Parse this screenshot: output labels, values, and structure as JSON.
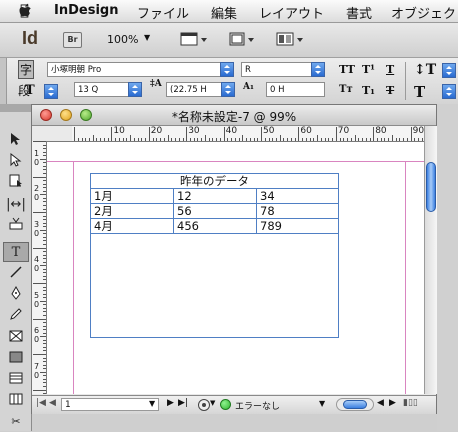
{
  "menubar": {
    "app_name": "InDesign",
    "items": [
      "ファイル",
      "編集",
      "レイアウト",
      "書式",
      "オブジェク"
    ]
  },
  "appbar": {
    "app_logo": "Id",
    "bridge_label": "Br",
    "zoom": "100%"
  },
  "control_panel": {
    "font_family": "小塚明朝 Pro",
    "font_style": "R",
    "font_size": "13 Q",
    "leading": "(22.75 H",
    "tracking": "0 H",
    "char_panel_label": "字",
    "para_panel_label": "段"
  },
  "document": {
    "title": "*名称未設定-7 @ 99%",
    "hruler_labels": [
      "10",
      "20",
      "30",
      "40",
      "50",
      "60",
      "70",
      "80",
      "90",
      "100"
    ],
    "vruler_labels": [
      "1\n0",
      "2\n0",
      "3\n0",
      "4\n0",
      "5\n0",
      "6\n0",
      "7\n0"
    ]
  },
  "table": {
    "title": "昨年のデータ",
    "rows": [
      [
        "1月",
        "12",
        "34"
      ],
      [
        "2月",
        "56",
        "78"
      ],
      [
        "4月",
        "456",
        "789"
      ]
    ]
  },
  "status_bar": {
    "page_number": "1",
    "preflight_status": "エラーなし",
    "preflight_color": "#2fb52f"
  },
  "icons": [
    "apple-icon",
    "selection-tool-icon",
    "direct-selection-tool-icon",
    "page-tool-icon",
    "gap-tool-icon",
    "content-collector-icon",
    "type-tool-icon",
    "line-tool-icon",
    "pen-tool-icon",
    "pencil-tool-icon",
    "rectangle-frame-tool-icon",
    "rectangle-tool-icon",
    "scissors-icon",
    "free-transform-icon"
  ]
}
